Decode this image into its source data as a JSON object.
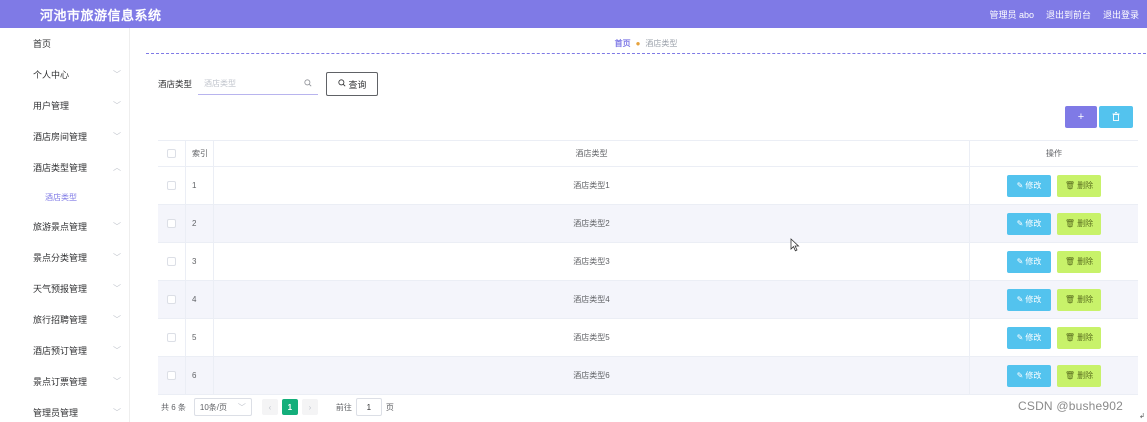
{
  "header": {
    "title": "河池市旅游信息系统",
    "user": "管理员 abo",
    "to_frontend": "退出到前台",
    "logout": "退出登录"
  },
  "sidebar": {
    "items": [
      {
        "label": "首页",
        "chevron": false
      },
      {
        "label": "个人中心",
        "chevron": true
      },
      {
        "label": "用户管理",
        "chevron": true
      },
      {
        "label": "酒店房间管理",
        "chevron": true
      },
      {
        "label": "酒店类型管理",
        "chevron": true
      },
      {
        "label": "酒店类型",
        "sub": true
      },
      {
        "label": "旅游景点管理",
        "chevron": true
      },
      {
        "label": "景点分类管理",
        "chevron": true
      },
      {
        "label": "天气预报管理",
        "chevron": true
      },
      {
        "label": "旅行招聘管理",
        "chevron": true
      },
      {
        "label": "酒店预订管理",
        "chevron": true
      },
      {
        "label": "景点订票管理",
        "chevron": true
      },
      {
        "label": "管理员管理",
        "chevron": true
      }
    ]
  },
  "breadcrumb": {
    "home": "首页",
    "current": "酒店类型"
  },
  "search": {
    "label": "酒店类型",
    "placeholder": "酒店类型",
    "button": "查询"
  },
  "toolbar": {
    "add_icon": "plus-icon",
    "delete_icon": "trash-icon"
  },
  "table": {
    "headers": {
      "index": "索引",
      "type": "酒店类型",
      "ops": "操作"
    },
    "edit_label": "修改",
    "delete_label": "删除",
    "rows": [
      {
        "index": "1",
        "type": "酒店类型1"
      },
      {
        "index": "2",
        "type": "酒店类型2"
      },
      {
        "index": "3",
        "type": "酒店类型3"
      },
      {
        "index": "4",
        "type": "酒店类型4"
      },
      {
        "index": "5",
        "type": "酒店类型5"
      },
      {
        "index": "6",
        "type": "酒店类型6"
      }
    ]
  },
  "pagination": {
    "total": "共 6 条",
    "page_size": "10条/页",
    "current_page": "1",
    "goto_prefix": "前往",
    "goto_value": "1",
    "goto_suffix": "页"
  },
  "watermark": "CSDN @bushe902",
  "colors": {
    "header": "#7f7ae6",
    "accent": "#7f7ae6",
    "edit": "#53c3ee",
    "delete": "#c8f26a",
    "active_page": "#13ae7a"
  }
}
